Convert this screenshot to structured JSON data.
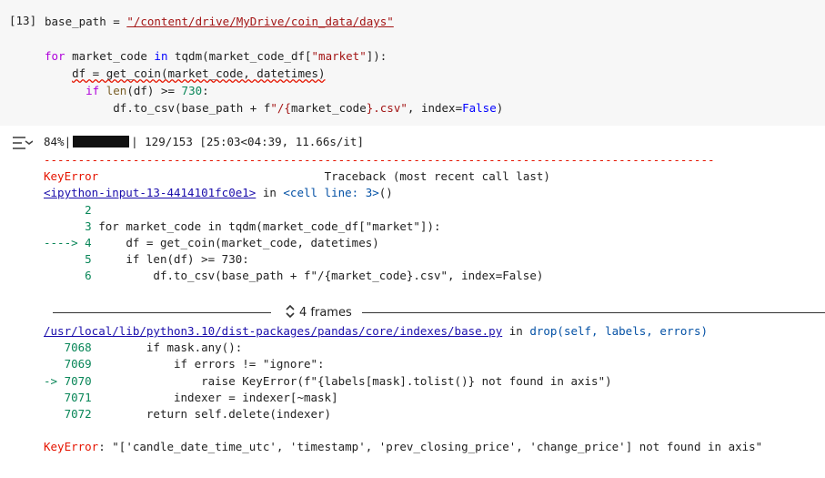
{
  "cell": {
    "exec_count": "[13]",
    "lines": {
      "l1_a": "base_path = ",
      "l1_str": "\"/content/drive/MyDrive/coin_data/days\"",
      "l2_for": "for",
      "l2_a": " market_code ",
      "l2_in": "in",
      "l2_b": " tqdm(market_code_df[",
      "l2_str": "\"market\"",
      "l2_c": "]):",
      "l3": "df = get_coin(market_code, datetimes)",
      "l4_if": "if",
      "l4_a": " ",
      "l4_len": "len",
      "l4_b": "(df) >= ",
      "l4_num": "730",
      "l4_c": ":",
      "l5_a": "df.to_csv(base_path + f",
      "l5_str1": "\"/{",
      "l5_mid": "market_code",
      "l5_str2": "}.csv\"",
      "l5_b": ", index=",
      "l5_false": "False",
      "l5_c": ")"
    }
  },
  "output": {
    "progress_pct": "84%|",
    "progress_fraction": 0.84,
    "progress_rest": "| 129/153 [25:03<04:39, 11.66s/it]",
    "dashes": "--------------------------------------------------------------------------------------------------",
    "error_name": "KeyError",
    "traceback_header": "Traceback (most recent call last)",
    "input_link": "<ipython-input-13-4414101fc0e1>",
    "in_word": " in ",
    "cell_line": "<cell line: 3>",
    "cell_line_tail": "()",
    "tb1": [
      {
        "no": "2",
        "code": ""
      },
      {
        "no": "3",
        "code": "for market_code in tqdm(market_code_df[\"market\"]):"
      },
      {
        "no": "4",
        "code": "    df = get_coin(market_code, datetimes)"
      },
      {
        "no": "5",
        "code": "    if len(df) >= 730:"
      },
      {
        "no": "6",
        "code": "        df.to_csv(base_path + f\"/{market_code}.csv\", index=False)"
      }
    ],
    "arrow": "----> ",
    "frames_label": "4 frames",
    "lib_path": "/usr/local/lib/python3.10/dist-packages/pandas/core/indexes/base.py",
    "drop_sig": "drop(self, labels, errors)",
    "tb2": [
      {
        "no": "7068",
        "code": "        if mask.any():"
      },
      {
        "no": "7069",
        "code": "            if errors != \"ignore\":"
      },
      {
        "no": "7070",
        "code": "                raise KeyError(f\"{labels[mask].tolist()} not found in axis\")"
      },
      {
        "no": "7071",
        "code": "            indexer = indexer[~mask]"
      },
      {
        "no": "7072",
        "code": "        return self.delete(indexer)"
      }
    ],
    "arrow2": "-> ",
    "final_error_name": "KeyError",
    "final_error_msg": ": \"['candle_date_time_utc', 'timestamp', 'prev_closing_price', 'change_price'] not found in axis\""
  },
  "colors": {
    "error": "#e51400",
    "lineno": "#098658",
    "link": "#1a0dab"
  }
}
